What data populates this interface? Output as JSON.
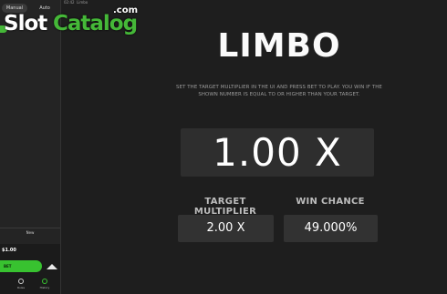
{
  "logo": {
    "slot": "Slot",
    "catalog": "Catalog",
    "com": ".com"
  },
  "sidebar": {
    "tabs": [
      "Manual",
      "Auto"
    ],
    "history_label": "New",
    "bet_amount": "$1.00",
    "bet_button": "BET",
    "bottom_buttons": [
      "Rules",
      "History"
    ]
  },
  "topbar": {
    "clock": "02:42",
    "game_name": "Limbo"
  },
  "game": {
    "title": "LIMBO",
    "instructions": "SET THE TARGET MULTIPLIER IN THE UI AND PRESS BET TO PLAY. YOU WIN IF THE SHOWN NUMBER IS EQUAL TO OR HIGHER THAN YOUR TARGET.",
    "multiplier": "1.00 X",
    "target_label": "TARGET MULTIPLIER",
    "target_value": "2.00 X",
    "chance_label": "WIN CHANCE",
    "chance_value": "49.000%"
  },
  "colors": {
    "accent": "#38c230",
    "background": "#1e1e1e",
    "panel": "#2e2e2e"
  },
  "icons": [
    "up-arrow-icon",
    "rules-icon",
    "history-icon"
  ]
}
